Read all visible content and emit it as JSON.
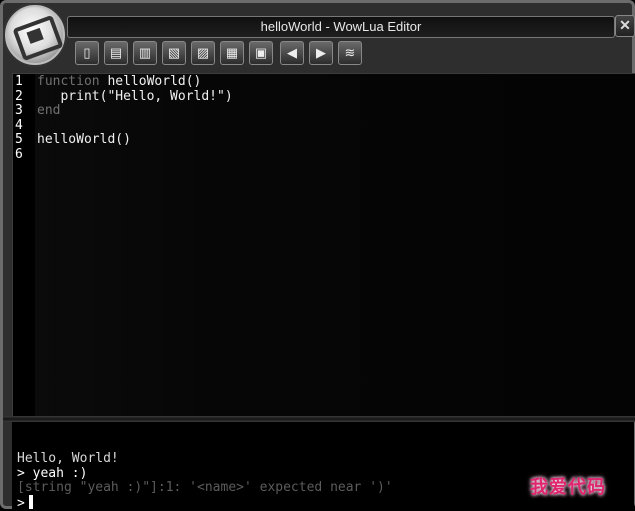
{
  "window": {
    "title": "helloWorld - WowLua Editor",
    "close_label": "✕"
  },
  "toolbar": [
    {
      "name": "new-page-button",
      "glyph": "▯"
    },
    {
      "name": "open-button",
      "glyph": "▤"
    },
    {
      "name": "save-button",
      "glyph": "▥"
    },
    {
      "name": "undo-button",
      "glyph": "▧"
    },
    {
      "name": "redo-button",
      "glyph": "▨"
    },
    {
      "name": "delete-button",
      "glyph": "▦"
    },
    {
      "name": "lock-button",
      "glyph": "▣"
    },
    {
      "name": "previous-button",
      "glyph": "◀"
    },
    {
      "name": "next-button",
      "glyph": "▶"
    },
    {
      "name": "run-button",
      "glyph": "≋"
    }
  ],
  "editor": {
    "lines": [
      {
        "number": "1",
        "segments": [
          {
            "text": "function",
            "style": "kw"
          },
          {
            "text": " helloWorld()",
            "style": "tx"
          }
        ]
      },
      {
        "number": "2",
        "segments": [
          {
            "text": "   print(\"Hello, World!\")",
            "style": "tx"
          }
        ]
      },
      {
        "number": "3",
        "segments": [
          {
            "text": "end",
            "style": "kw"
          }
        ]
      },
      {
        "number": "4",
        "segments": []
      },
      {
        "number": "5",
        "segments": [
          {
            "text": "helloWorld()",
            "style": "tx"
          }
        ]
      },
      {
        "number": "6",
        "segments": []
      }
    ]
  },
  "console": {
    "output_lines": [
      {
        "text": "Hello, World!",
        "color": "#d8d8d8"
      },
      {
        "text": "> yeah :)",
        "color": "#ffffff"
      },
      {
        "text": "[string \"yeah :)\"]:1: '<name>' expected near ')'",
        "color": "#5c5c5c"
      }
    ],
    "prompt": ">",
    "input_value": ""
  },
  "watermark": "我爱代码"
}
